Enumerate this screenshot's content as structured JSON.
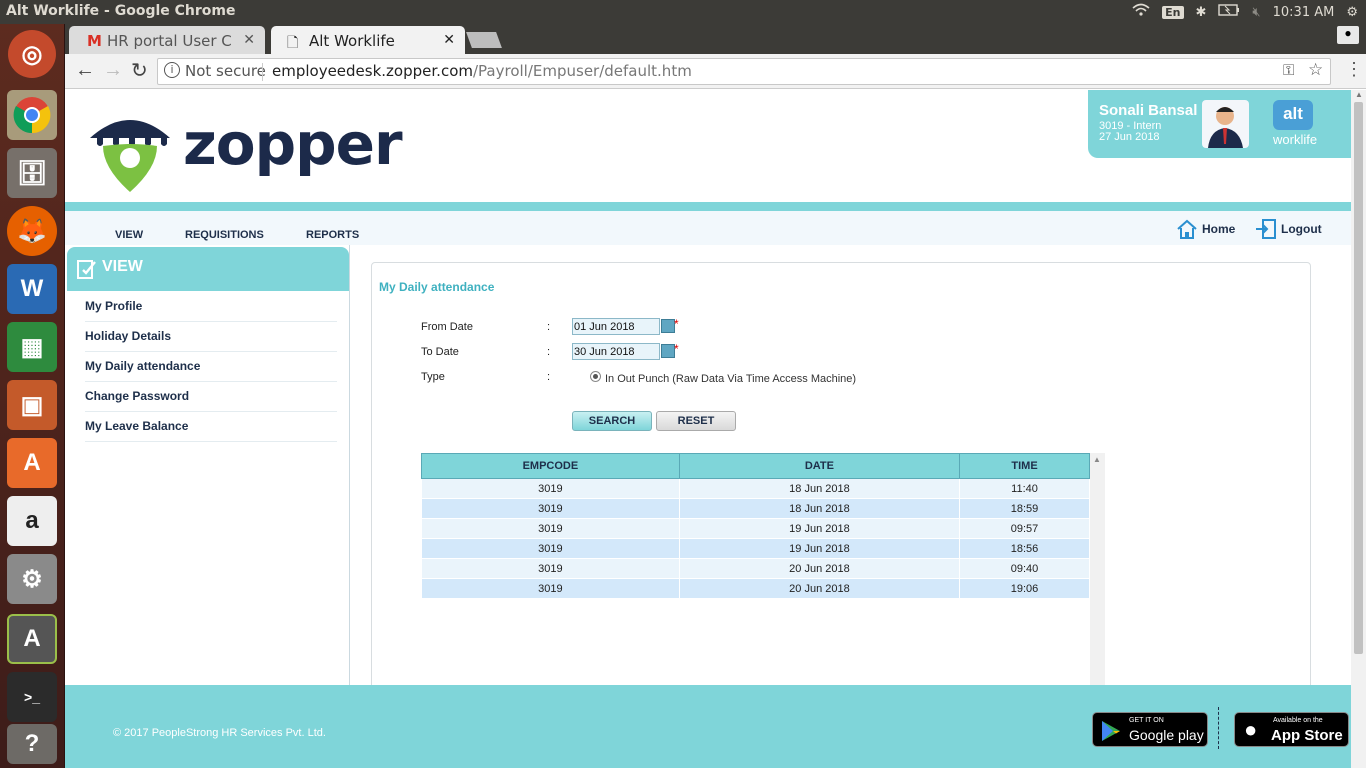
{
  "os": {
    "window_title": "Alt Worklife - Google Chrome",
    "keyboard_layout": "En",
    "clock": "10:31 AM"
  },
  "browser": {
    "tabs": [
      {
        "label": "HR portal User Cred",
        "icon": "gmail-icon"
      },
      {
        "label": "Alt Worklife",
        "icon": "page-icon"
      }
    ],
    "security_label": "Not secure",
    "url_host": "employeedesk.zopper.com",
    "url_path": "/Payroll/Empuser/default.htm"
  },
  "header": {
    "logo_text": "zopper",
    "user_name": "Sonali Bansal",
    "user_detail": "3019 - Intern",
    "user_date": "27 Jun 2018",
    "brand_badge": "alt",
    "brand_text": "worklife"
  },
  "nav": {
    "items": [
      "VIEW",
      "REQUISITIONS",
      "REPORTS"
    ],
    "home_label": "Home",
    "logout_label": "Logout"
  },
  "sidebar": {
    "heading": "VIEW",
    "items": [
      "My Profile",
      "Holiday Details",
      "My Daily attendance",
      "Change Password",
      "My Leave Balance"
    ]
  },
  "main": {
    "title": "My Daily attendance",
    "from_label": "From Date",
    "to_label": "To Date",
    "type_label": "Type",
    "colon": ":",
    "required_mark": "*",
    "from_value": "01 Jun 2018",
    "to_value": "30 Jun 2018",
    "type_option": "In Out Punch (Raw Data Via Time Access Machine)",
    "search_label": "SEARCH",
    "reset_label": "RESET",
    "table": {
      "headers": [
        "EMPCODE",
        "DATE",
        "TIME"
      ],
      "rows": [
        [
          "3019",
          "18 Jun 2018",
          "11:40"
        ],
        [
          "3019",
          "18 Jun 2018",
          "18:59"
        ],
        [
          "3019",
          "19 Jun 2018",
          "09:57"
        ],
        [
          "3019",
          "19 Jun 2018",
          "18:56"
        ],
        [
          "3019",
          "20 Jun 2018",
          "09:40"
        ],
        [
          "3019",
          "20 Jun 2018",
          "19:06"
        ]
      ]
    }
  },
  "footer": {
    "copyright": "© 2017 PeopleStrong HR Services Pvt. Ltd.",
    "google_small": "GET IT ON",
    "google_big": "Google play",
    "apple_small": "Available on the",
    "apple_big": "App Store"
  },
  "colors": {
    "accent": "#7fd5d9",
    "navy": "#1e2f4a"
  }
}
